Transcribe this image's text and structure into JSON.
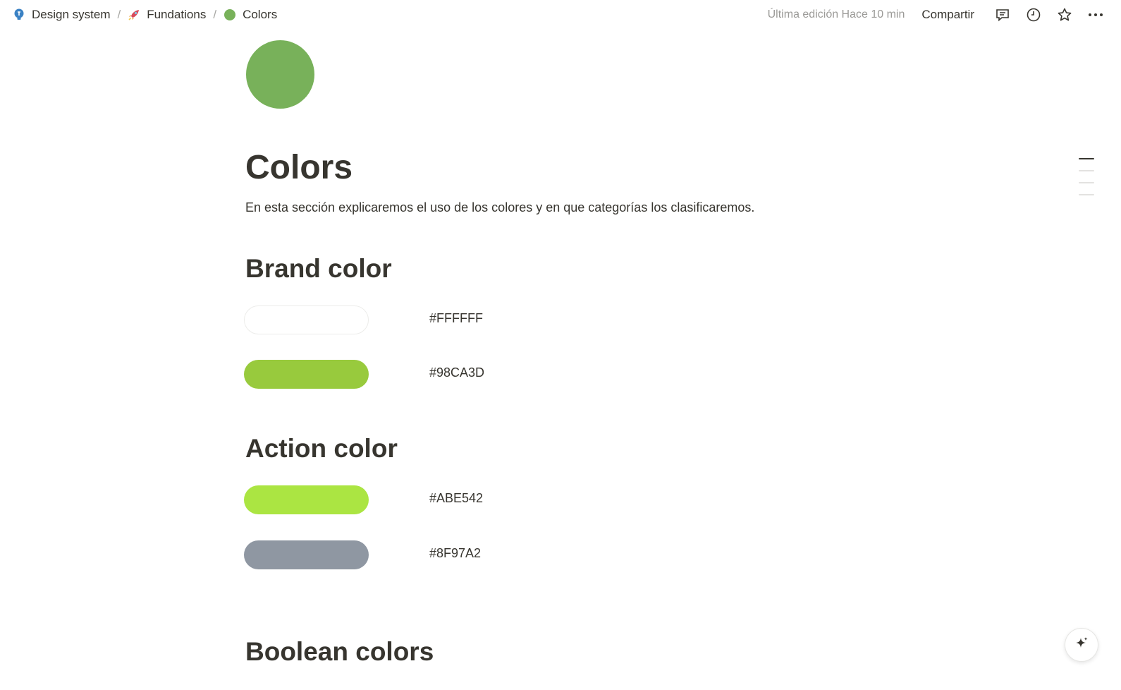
{
  "breadcrumb": {
    "items": [
      {
        "label": "Design system",
        "icon": "lightbulb-icon"
      },
      {
        "label": "Fundations",
        "icon": "rocket-icon"
      },
      {
        "label": "Colors",
        "icon": "green-circle-icon"
      }
    ],
    "separator": "/"
  },
  "topbar": {
    "edited": "Última edición Hace 10 min",
    "share_label": "Compartir",
    "icons": [
      "comment-icon",
      "history-clock-icon",
      "favorite-star-icon",
      "more-icon"
    ]
  },
  "page": {
    "icon_color": "#78B15A",
    "title": "Colors",
    "description": "En esta sección explicaremos el uso de los colores y en que categorías los clasificaremos."
  },
  "sections": {
    "brand": {
      "heading": "Brand color",
      "swatches": [
        {
          "hex": "#FFFFFF",
          "color": "#FFFFFF"
        },
        {
          "hex": "#98CA3D",
          "color": "#98CA3D"
        }
      ]
    },
    "action": {
      "heading": "Action color",
      "swatches": [
        {
          "hex": "#ABE542",
          "color": "#ABE542"
        },
        {
          "hex": "#8F97A2",
          "color": "#8F97A2"
        }
      ]
    },
    "boolean": {
      "heading": "Boolean colors"
    }
  },
  "ai_button": {
    "icon": "sparkle-icon"
  }
}
